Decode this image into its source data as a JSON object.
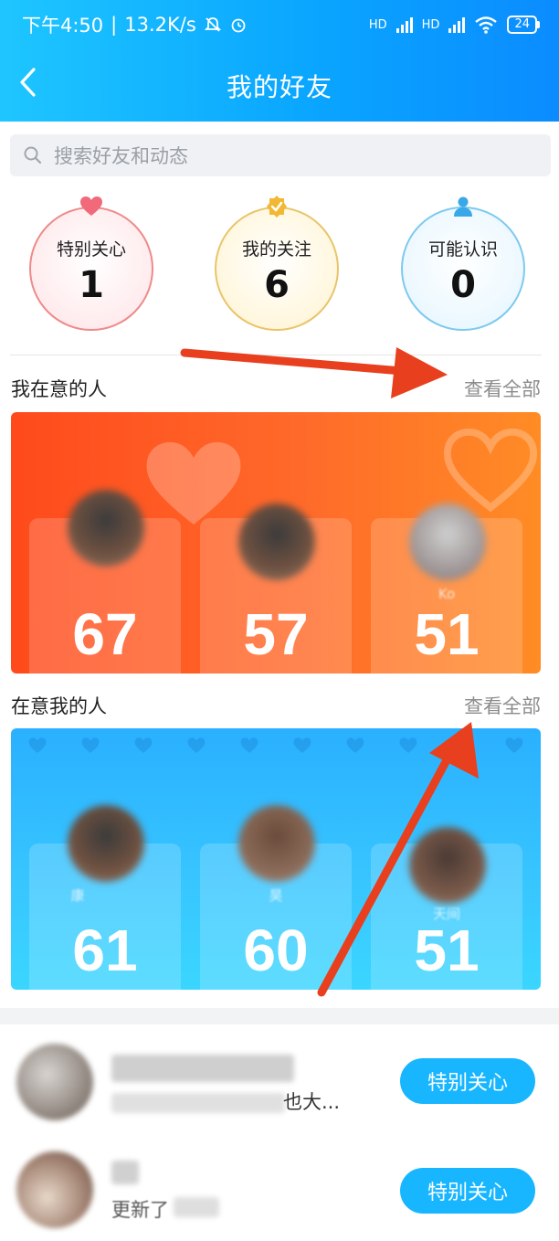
{
  "status_bar": {
    "time": "下午4:50",
    "speed": "13.2K/s",
    "network_1": "HD",
    "network_2": "HD",
    "battery": "24"
  },
  "header": {
    "title": "我的好友"
  },
  "search": {
    "placeholder": "搜索好友和动态"
  },
  "stats": [
    {
      "label": "特别关心",
      "count": "1",
      "color": "#ef8a8a",
      "fill": "#ffe3e6",
      "icon": "heart-icon"
    },
    {
      "label": "我的关注",
      "count": "6",
      "color": "#e8c56a",
      "fill": "#fff3cf",
      "icon": "verified-badge-icon"
    },
    {
      "label": "可能认识",
      "count": "0",
      "color": "#7ec9ef",
      "fill": "#e3f5ff",
      "icon": "person-icon"
    }
  ],
  "sections": {
    "i_care": {
      "title": "我在意的人",
      "see_all": "查看全部",
      "people": [
        {
          "score": "67",
          "name": ""
        },
        {
          "score": "57",
          "name": ""
        },
        {
          "score": "51",
          "name": "Ko"
        }
      ]
    },
    "care_me": {
      "title": "在意我的人",
      "see_all": "查看全部",
      "people": [
        {
          "score": "61",
          "name": "康"
        },
        {
          "score": "60",
          "name": "昊"
        },
        {
          "score": "51",
          "name": "天间"
        }
      ]
    }
  },
  "friend_list": [
    {
      "snippet": "也大...",
      "button": "特别关心"
    },
    {
      "snippet": "更新了",
      "button": "特别关心"
    }
  ]
}
